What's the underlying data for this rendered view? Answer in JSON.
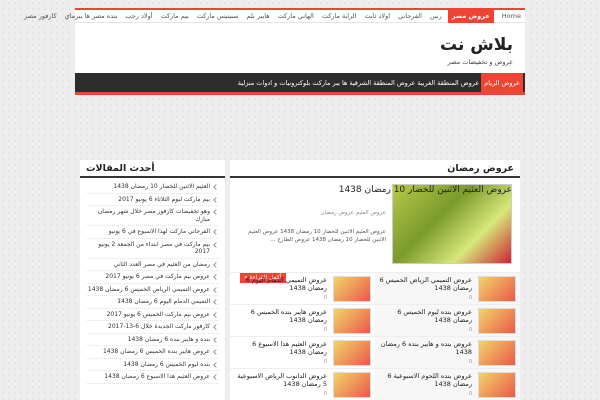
{
  "topbar": {
    "items": [
      "كارفور مصر",
      "بنده مصر ها يبرماي",
      "أولاد رجب",
      "بيم ماركت",
      "سبينيس ماركت",
      "هايبر بلم",
      "الهاني ماركت",
      "الراية ماركت",
      "اولاد ثابت",
      "الفرجاني",
      "رنين",
      "عروض مصر",
      "Home"
    ],
    "active_index": 11
  },
  "header": {
    "title": "بلاش نت",
    "subtitle": "عروض و تخفيضات مصر"
  },
  "menu": {
    "items": [
      "عروض الريام",
      "عروض المنطقة الغربية",
      "عروض المنطقة الشرقية",
      "ها يبر ماركت بلوكترونيات و ادوات منزلية"
    ]
  },
  "main": {
    "section_title": "عروض رمضان",
    "featured": {
      "title": "عروض العثيم الاثنين للخضار 10 رمضان 1438",
      "meta": "عروض العثيم عروض رمضان",
      "excerpt": "عروض العثيم الاثنين للخضار 10 رمضان 1438 عروض العثيم الاثنين للخضار 10 رمضان 1438 عروض الطازج ...",
      "more_label": "أكمل القراءة »",
      "icon_color": "#e44433"
    },
    "items": [
      {
        "text": "عروض التميمي الرياض الخميس 6 رمضان 1438",
        "meta": "0"
      },
      {
        "text": "عروض التميمي الدمام اليوم 6 رمضان 1438",
        "meta": "0"
      },
      {
        "text": "عروض بنده ليوم الخميس 6 رمضان 1438",
        "meta": "0"
      },
      {
        "text": "عروض هايبر بنده الخميس 6 رمضان 1438",
        "meta": "0"
      },
      {
        "text": "عروض بنده و هايبر بنده 6 رمضان 1438",
        "meta": "0"
      },
      {
        "text": "عروض العثيم هذا الاسبوع 6 رمضان 1438",
        "meta": "0"
      },
      {
        "text": "عروض بنده اللحوم الاسبوعية 6 رمضان 1438",
        "meta": "0"
      },
      {
        "text": "عروض الدانوب الرياض الاسبوعية 5 رمضان 1438",
        "meta": "0"
      }
    ]
  },
  "sidebar": {
    "title": "أحدث المقالات",
    "items": [
      "العثيم الاثنين للخضار 10 رمضان 1438",
      "بيم ماركت ليوم الثلاثاء 6 يونيو 2017",
      "وهو تخفيضات كارفور مصر خلال شهر رمضان مبارك",
      "الفرجاني ماركت لهذا الاسبوع في 6 يونيو",
      "بيم ماركت في مصر ابتداء من الجمعة 2 يونيو 2017",
      "رمضان من العثيم في مصر العدد الثاني",
      "عروض بيم ماركت في مصر 6 يونيو 2017",
      "عروض التميمي الرياض الخميس 6 رمضان 1438",
      "التميمي الدمام اليوم 6 رمضان 1438",
      "عروض بيم ماركت الخميس 6 يونيو 2017",
      "كارفور ماركت الجديدة خلال 6-13-2017",
      "بنده و هايبر بنده 6 رمضان 1438",
      "عروض هايبر بنده الخميس 6 رمضان 1438",
      "بنده ليوم الخميس 6 رمضان 1438",
      "عروض العثيم هذا الاسبوع 6 رمضان 1438"
    ]
  }
}
